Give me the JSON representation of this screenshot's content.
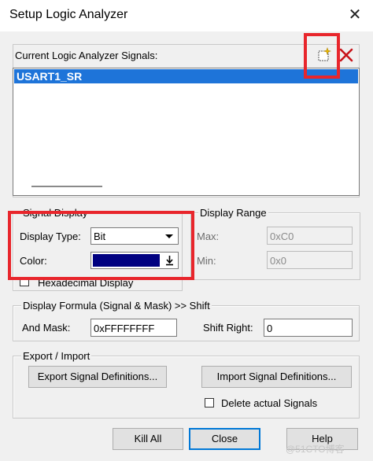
{
  "window": {
    "title": "Setup Logic Analyzer",
    "close_glyph": "✕"
  },
  "signals": {
    "header_label": "Current Logic Analyzer Signals:",
    "new_icon": "new-signal-icon",
    "delete_icon": "delete-signal-icon",
    "items": [
      "USART1_SR"
    ],
    "selected_index": 0
  },
  "signal_display": {
    "group_label": "Signal Display",
    "display_type_label": "Display Type:",
    "display_type_value": "Bit",
    "color_label": "Color:",
    "color_value": "#000080",
    "hex_label": "Hexadecimal Display"
  },
  "display_range": {
    "group_label": "Display Range",
    "max_label": "Max:",
    "max_value": "0xC0",
    "min_label": "Min:",
    "min_value": "0x0"
  },
  "formula": {
    "group_label": "Display Formula (Signal & Mask) >> Shift",
    "and_mask_label": "And Mask:",
    "and_mask_value": "0xFFFFFFFF",
    "shift_right_label": "Shift Right:",
    "shift_right_value": "0"
  },
  "export_import": {
    "group_label": "Export / Import",
    "export_button": "Export Signal Definitions...",
    "import_button": "Import Signal Definitions...",
    "delete_actual_label": "Delete actual Signals"
  },
  "footer": {
    "kill_all": "Kill All",
    "close": "Close",
    "help": "Help"
  },
  "watermark": "@51CTO博客",
  "colors": {
    "highlight": "#1e74d9",
    "annotation_red": "#e8262c",
    "navy": "#000080"
  }
}
